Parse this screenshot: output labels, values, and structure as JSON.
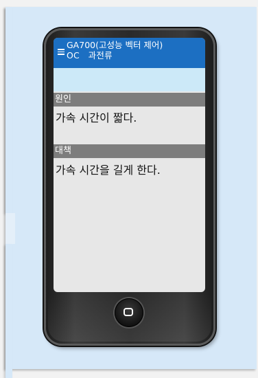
{
  "app": {
    "title_line1": "GA700(고성능 벡터 제어)",
    "title_line2": "OC　과전류"
  },
  "sections": [
    {
      "header": "원인",
      "text": "가속 시간이 짧다."
    },
    {
      "header": "대책",
      "text": "가속 시간을 길게 한다."
    }
  ],
  "colors": {
    "page_bg": "#d6e8f8",
    "titlebar": "#1c6fc2",
    "highlight_row": "#cce9f8",
    "section_header": "#7d7d7d",
    "screen_bg": "#e7e7e7",
    "phone_body": "#2a2a2a"
  },
  "icons": {
    "menu": "hamburger-menu-icon",
    "home": "home-button-icon"
  }
}
